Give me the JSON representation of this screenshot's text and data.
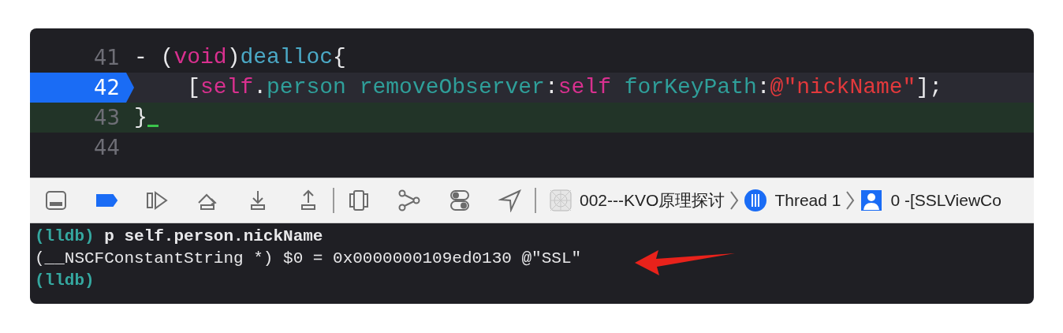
{
  "editor": {
    "lines": [
      {
        "number": "41",
        "breakpoint": false,
        "current": false,
        "focused": false,
        "tokens": [
          {
            "text": "- (",
            "kind": "plain"
          },
          {
            "text": "void",
            "kind": "keyword"
          },
          {
            "text": ")",
            "kind": "plain"
          },
          {
            "text": "dealloc",
            "kind": "method"
          },
          {
            "text": "{",
            "kind": "plain"
          }
        ]
      },
      {
        "number": "42",
        "breakpoint": true,
        "current": false,
        "focused": true,
        "tokens": [
          {
            "text": "    [",
            "kind": "plain"
          },
          {
            "text": "self",
            "kind": "keyword"
          },
          {
            "text": ".",
            "kind": "plain"
          },
          {
            "text": "person removeObserver",
            "kind": "identifier"
          },
          {
            "text": ":",
            "kind": "plain"
          },
          {
            "text": "self",
            "kind": "keyword"
          },
          {
            "text": " forKeyPath",
            "kind": "identifier"
          },
          {
            "text": ":",
            "kind": "plain"
          },
          {
            "text": "@\"nickName\"",
            "kind": "string"
          },
          {
            "text": "];",
            "kind": "plain"
          }
        ]
      },
      {
        "number": "43",
        "breakpoint": false,
        "current": true,
        "focused": false,
        "tokens": [
          {
            "text": "}",
            "kind": "plain"
          }
        ]
      },
      {
        "number": "44",
        "breakpoint": false,
        "current": false,
        "focused": false
      }
    ]
  },
  "debug_bar": {
    "breakpoints_active": true,
    "breadcrumbs": [
      {
        "kind": "project",
        "label": "002---KVO原理探讨"
      },
      {
        "kind": "thread",
        "label": "Thread 1"
      },
      {
        "kind": "frame",
        "label": "0 -[SSLViewCo"
      }
    ]
  },
  "console": {
    "lines": [
      {
        "prompt": "(lldb)",
        "text": " p self.person.nickName"
      },
      {
        "text": "(__NSCFConstantString *) $0 = 0x0000000109ed0130 @\"SSL\""
      },
      {
        "prompt": "(lldb)"
      }
    ]
  }
}
